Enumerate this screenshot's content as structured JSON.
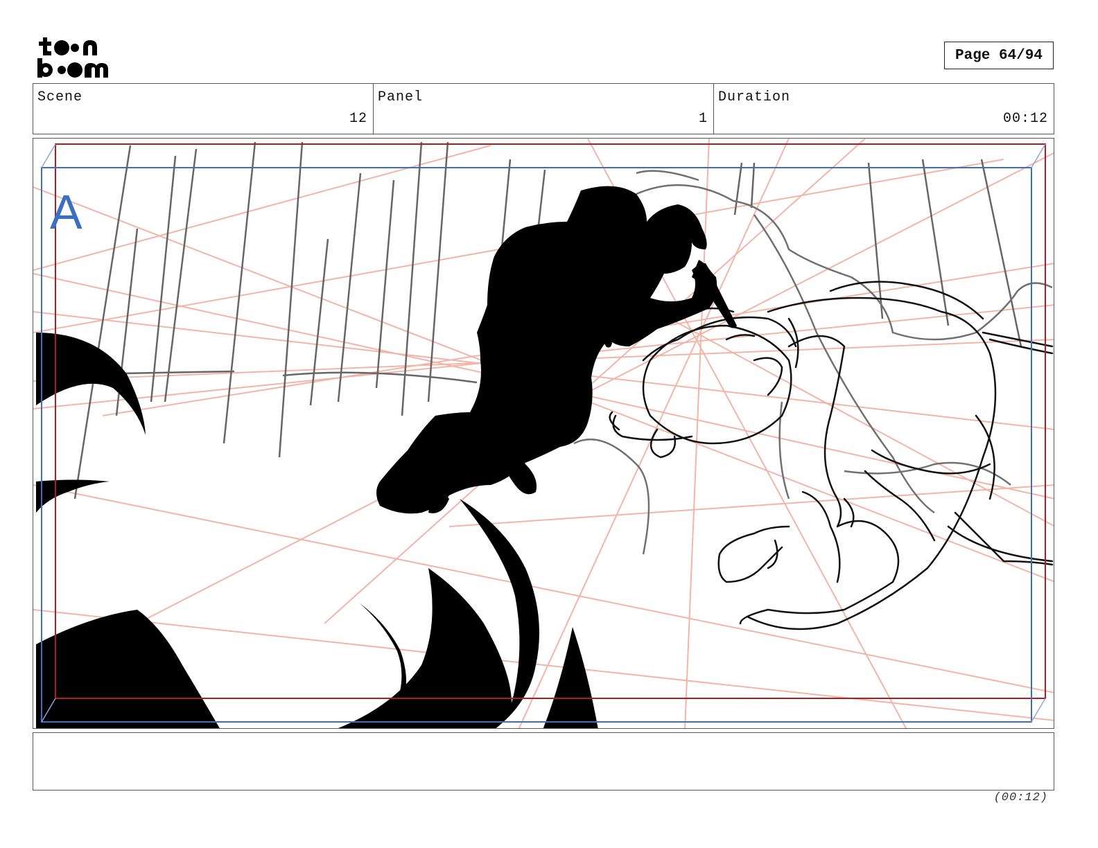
{
  "brand": {
    "logo_text_top": "toon",
    "logo_text_bottom": "boom"
  },
  "header": {
    "page_label": "Page 64/94"
  },
  "info": {
    "scene_label": "Scene",
    "scene_value": "12",
    "panel_label": "Panel",
    "panel_value": "1",
    "duration_label": "Duration",
    "duration_value": "00:12"
  },
  "panel_image": {
    "layer_letter": "A",
    "colors": {
      "camera_frame": "#3a6fc4",
      "safe_frame": "#b01c24",
      "perspective": "#f2a89a",
      "ink": "#000000"
    }
  },
  "footer": {
    "duration": "(00:12)"
  }
}
